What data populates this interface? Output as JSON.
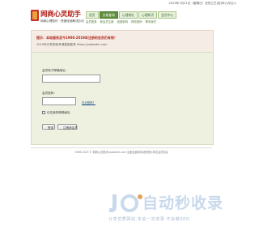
{
  "header": {
    "date_text": "2025年7月21日（星期日）农历乙巳(蛇)年六月廿六",
    "logo_title": "网商心灵助手",
    "logo_subtitle": "网商心理知识 · 快速找到解决办法",
    "nav": [
      "首页",
      "交易查询",
      "心理地址",
      "心理知识",
      "会员中心"
    ],
    "subnav": [
      "会员登录",
      "新会员注册",
      "找回密码",
      "修改密码",
      "联系我们"
    ]
  },
  "notice": {
    "line1": "提示：本站服务至今1998-2019年注册的会员仍有效！",
    "line2": "2019年已有的帐号请直接登录 https://yoobetm.com"
  },
  "form": {
    "email_label": "会员电子邮箱地址：",
    "email_value": "",
    "password_label": "会员密码：",
    "password_value": "",
    "forgot_link": "忘记密码？",
    "remember_label": "记住我的邮箱地址",
    "login_button": "登录",
    "register_button": "注册新会员"
  },
  "footer": {
    "text": "1998-2023 © 网商心灵助手yoobetm.com 注册及使用本站即表示同意会员协议"
  },
  "watermark": {
    "title": "自动秒收录",
    "subtitle": "分享优质网站·本站一次收录·不会做SEO"
  },
  "colors": {
    "brand_red": "#b2221c",
    "nav_green": "#5f8f3c",
    "panel_bg": "#eef0e0",
    "notice_bg": "#f5ede5"
  }
}
